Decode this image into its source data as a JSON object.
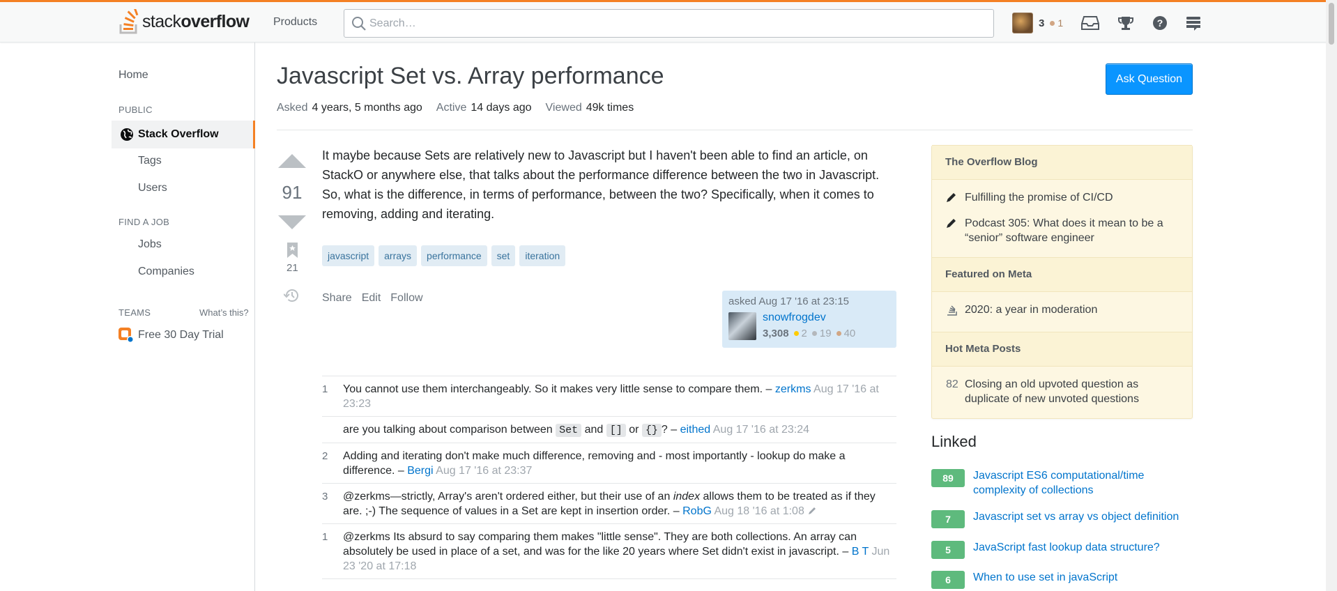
{
  "header": {
    "logo_plain": "stack",
    "logo_bold": "overflow",
    "products": "Products",
    "search_placeholder": "Search…",
    "reputation": "3",
    "bronze_badges": "1"
  },
  "sidebar": {
    "home": "Home",
    "public_label": "PUBLIC",
    "stack_overflow": "Stack Overflow",
    "tags": "Tags",
    "users": "Users",
    "find_job_label": "FIND A JOB",
    "jobs": "Jobs",
    "companies": "Companies",
    "teams_label": "TEAMS",
    "whats_this": "What’s this?",
    "free_trial": "Free 30 Day Trial"
  },
  "question": {
    "title": "Javascript Set vs. Array performance",
    "ask_button": "Ask Question",
    "asked_label": "Asked",
    "asked_value": "4 years, 5 months ago",
    "active_label": "Active",
    "active_value": "14 days ago",
    "viewed_label": "Viewed",
    "viewed_value": "49k times",
    "votes": "91",
    "bookmarks": "21",
    "body": "It maybe because Sets are relatively new to Javascript but I haven't been able to find an article, on StackO or anywhere else, that talks about the performance difference between the two in Javascript. So, what is the difference, in terms of performance, between the two? Specifically, when it comes to removing, adding and iterating.",
    "tags": [
      "javascript",
      "arrays",
      "performance",
      "set",
      "iteration"
    ],
    "actions": {
      "share": "Share",
      "edit": "Edit",
      "follow": "Follow"
    },
    "owner": {
      "asked": "asked Aug 17 '16 at 23:15",
      "name": "snowfrogdev",
      "rep": "3,308",
      "gold": "2",
      "silver": "19",
      "bronze": "40"
    }
  },
  "comments": [
    {
      "score": "1",
      "text": "You cannot use them interchangeably. So it makes very little sense to compare them. –",
      "user": "zerkms",
      "date": "Aug 17 '16 at 23:23"
    },
    {
      "score": "",
      "pre": "are you talking about comparison between",
      "code1": "Set",
      "mid1": "and",
      "code2": "[]",
      "mid2": "or",
      "code3": "{}",
      "post": "? –",
      "user": "eithed",
      "date": "Aug 17 '16 at 23:24"
    },
    {
      "score": "2",
      "text": "Adding and iterating don't make much difference, removing and - most importantly - lookup do make a difference. –",
      "user": "Bergi",
      "date": "Aug 17 '16 at 23:37"
    },
    {
      "score": "3",
      "pre": "@zerkms—strictly, Array's aren't ordered either, but their use of an",
      "em": "index",
      "post": "allows them to be treated as if they are. ;-) The sequence of values in a Set are kept in insertion order. –",
      "user": "RobG",
      "date": "Aug 18 '16 at 1:08"
    },
    {
      "score": "1",
      "text": "@zerkms Its absurd to say comparing them makes \"little sense\". They are both collections. An array can absolutely be used in place of a set, and was for the like 20 years where Set didn't exist in javascript. –",
      "user": "B T",
      "date": "Jun 23 '20 at 17:18"
    }
  ],
  "right": {
    "blog_header": "The Overflow Blog",
    "blog_items": [
      "Fulfilling the promise of CI/CD",
      "Podcast 305: What does it mean to be a “senior” software engineer"
    ],
    "meta_header": "Featured on Meta",
    "meta_items": [
      "2020: a year in moderation"
    ],
    "hot_header": "Hot Meta Posts",
    "hot_items": [
      {
        "count": "82",
        "text": "Closing an old upvoted question as duplicate of new unvoted questions"
      }
    ],
    "linked_header": "Linked",
    "linked": [
      {
        "count": "89",
        "text": "Javascript ES6 computational/time complexity of collections"
      },
      {
        "count": "7",
        "text": "Javascript set vs array vs object definition"
      },
      {
        "count": "5",
        "text": "JavaScript fast lookup data structure?"
      },
      {
        "count": "6",
        "text": "When to use set in javaScript"
      }
    ]
  },
  "colors": {
    "accent": "#f48024",
    "link": "#0074cc",
    "primary_button": "#0a95ff",
    "tag_bg": "#e1ecf4",
    "answered_green": "#5eba7d"
  },
  "icons": [
    "stackoverflow-logo-icon",
    "search-icon",
    "inbox-icon",
    "trophy-icon",
    "help-icon",
    "site-switcher-icon",
    "globe-icon",
    "upvote-icon",
    "downvote-icon",
    "bookmark-icon",
    "history-icon",
    "pencil-icon",
    "meta-icon",
    "teams-icon"
  ]
}
